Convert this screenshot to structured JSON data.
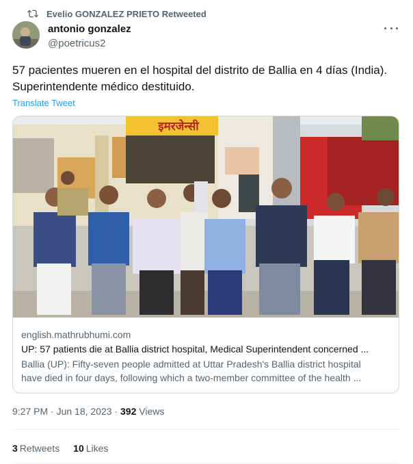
{
  "retweet": {
    "label": "Evelio GONZALEZ PRIETO Retweeted",
    "icon": "retweet-icon"
  },
  "author": {
    "name": "antonio gonzalez",
    "handle": "@poetricus2"
  },
  "tweet": {
    "text_line1": "57 pacientes mueren en el hospital del distrito de Ballia en 4 días (India).",
    "text_line2": "Superintendente médico destituido.",
    "translate_label": "Translate Tweet"
  },
  "card": {
    "sign_text": "इमरजेन्सी",
    "domain": "english.mathrubhumi.com",
    "title": "UP: 57 patients die at Ballia district hospital, Medical Superintendent concerned ...",
    "desc_line1": "Ballia (UP): Fifty-seven people admitted at Uttar Pradesh's Ballia district hospital",
    "desc_line2": "have died in four days, following which a two-member committee of the health ..."
  },
  "meta": {
    "time": "9:27 PM",
    "sep": " · ",
    "date": "Jun 18, 2023",
    "dot": " · ",
    "views_count": "392",
    "views_label": " Views"
  },
  "stats": {
    "retweets_count": "3",
    "retweets_label": "Retweets",
    "likes_count": "10",
    "likes_label": "Likes"
  },
  "colors": {
    "link": "#1d9bf0",
    "secondary": "#536471",
    "primary": "#0f1419",
    "border": "#cfd9de"
  }
}
